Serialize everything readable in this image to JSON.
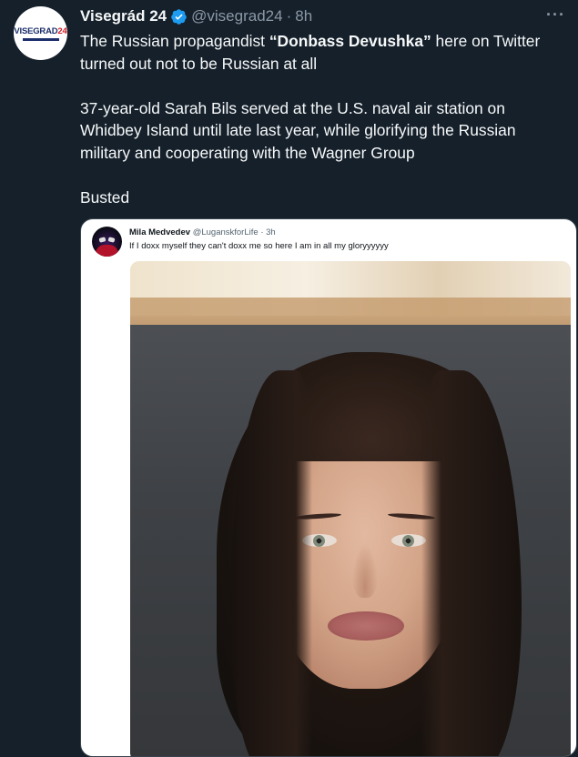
{
  "tweet": {
    "avatar_text_main": "VISEGRAD",
    "avatar_text_num": "24",
    "author_name": "Visegrád 24",
    "author_handle": "@visegrad24",
    "separator": "·",
    "time": "8h",
    "more": "···",
    "para1_pre": "The Russian propagandist ",
    "para1_bold": "“Donbass Devushka”",
    "para1_post": " here on Twitter turned out not to be Russian at all",
    "para2": "37-year-old Sarah Bils served at the U.S. naval air station on Whidbey Island until late last year, while glorifying the Russian military and cooperating with the Wagner Group",
    "para3": "Busted"
  },
  "embedded": {
    "name": "Mila Medvedev",
    "handle": "@LuganskforLife",
    "separator": "·",
    "time": "3h",
    "text": "If I doxx myself they can't doxx me so here I am in all my gloryyyyyy"
  },
  "colors": {
    "background": "#15202b",
    "verified_badge": "#1d9bf0",
    "secondary_text": "#8b98a5"
  }
}
